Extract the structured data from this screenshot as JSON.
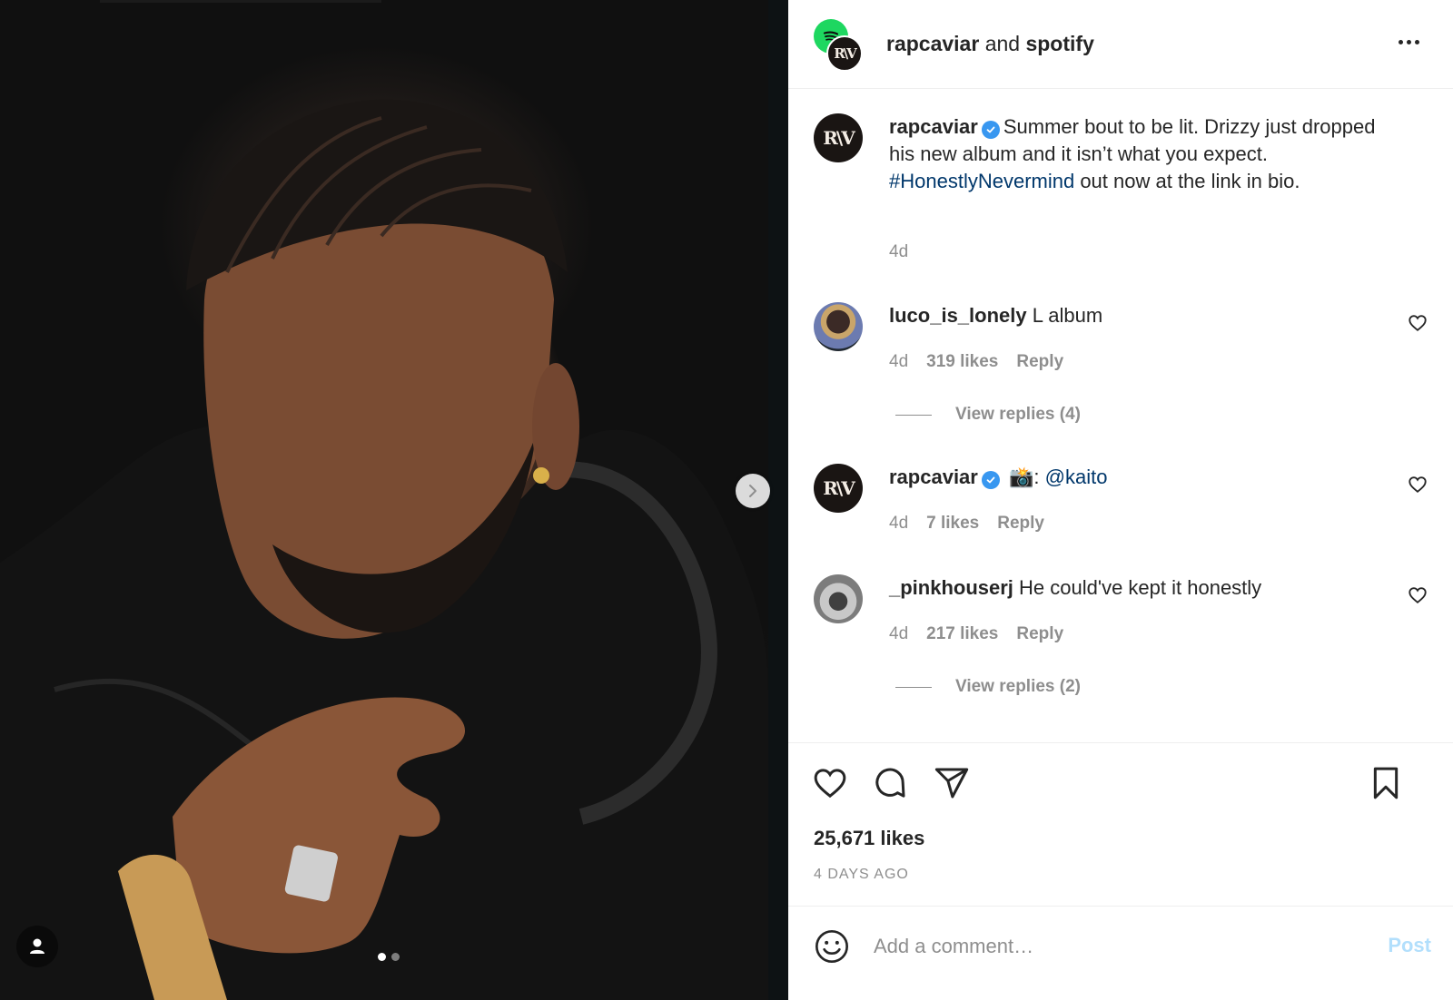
{
  "media": {
    "carousel_dots": 2,
    "active_dot": 0
  },
  "header": {
    "account": "rapcaviar",
    "connector": "and",
    "collaborator": "spotify",
    "avatar_text": "R\\V"
  },
  "caption": {
    "username": "rapcaviar",
    "text_before": "Summer bout to be lit. Drizzy just dropped his new album and it isn’t what you expect. ",
    "hashtag": "#HonestlyNevermind",
    "text_after": " out now at the link in bio.",
    "time": "4d",
    "avatar_text": "R\\V"
  },
  "comments": [
    {
      "username": "luco_is_lonely",
      "text": "L album",
      "time": "4d",
      "likes": "319 likes",
      "reply": "Reply",
      "view_replies": "View replies (4)"
    },
    {
      "username": "rapcaviar",
      "emoji": "📸",
      "text": ": ",
      "mention": "@kaito",
      "time": "4d",
      "likes": "7 likes",
      "reply": "Reply",
      "avatar_text": "R\\V"
    },
    {
      "username": "_pinkhouserj",
      "text": "He could've kept it honestly",
      "time": "4d",
      "likes": "217 likes",
      "reply": "Reply",
      "view_replies": "View replies (2)"
    }
  ],
  "post": {
    "likes": "25,671 likes",
    "time_ago": "4 DAYS AGO"
  },
  "composer": {
    "placeholder": "Add a comment…",
    "post_label": "Post"
  },
  "colors": {
    "link": "#00376b",
    "verified": "#3897f0",
    "spotify": "#1ed760",
    "post_disabled": "#b2dffc"
  }
}
